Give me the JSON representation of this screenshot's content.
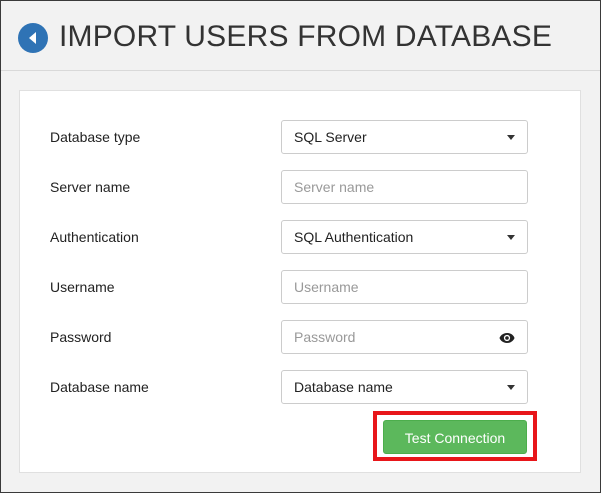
{
  "header": {
    "title": "IMPORT USERS FROM DATABASE",
    "back_icon": "chevron-left-icon",
    "accent_color": "#2f73b5"
  },
  "form": {
    "database_type": {
      "label": "Database type",
      "value": "SQL Server"
    },
    "server_name": {
      "label": "Server name",
      "placeholder": "Server name",
      "value": ""
    },
    "authentication": {
      "label": "Authentication",
      "value": "SQL Authentication"
    },
    "username": {
      "label": "Username",
      "placeholder": "Username",
      "value": ""
    },
    "password": {
      "label": "Password",
      "placeholder": "Password",
      "value": "",
      "toggle_icon": "eye-icon"
    },
    "database_name": {
      "label": "Database name",
      "value": "Database name"
    }
  },
  "actions": {
    "test_connection_label": "Test Connection",
    "button_color": "#5cb85c",
    "highlight_color": "#e8161a"
  }
}
